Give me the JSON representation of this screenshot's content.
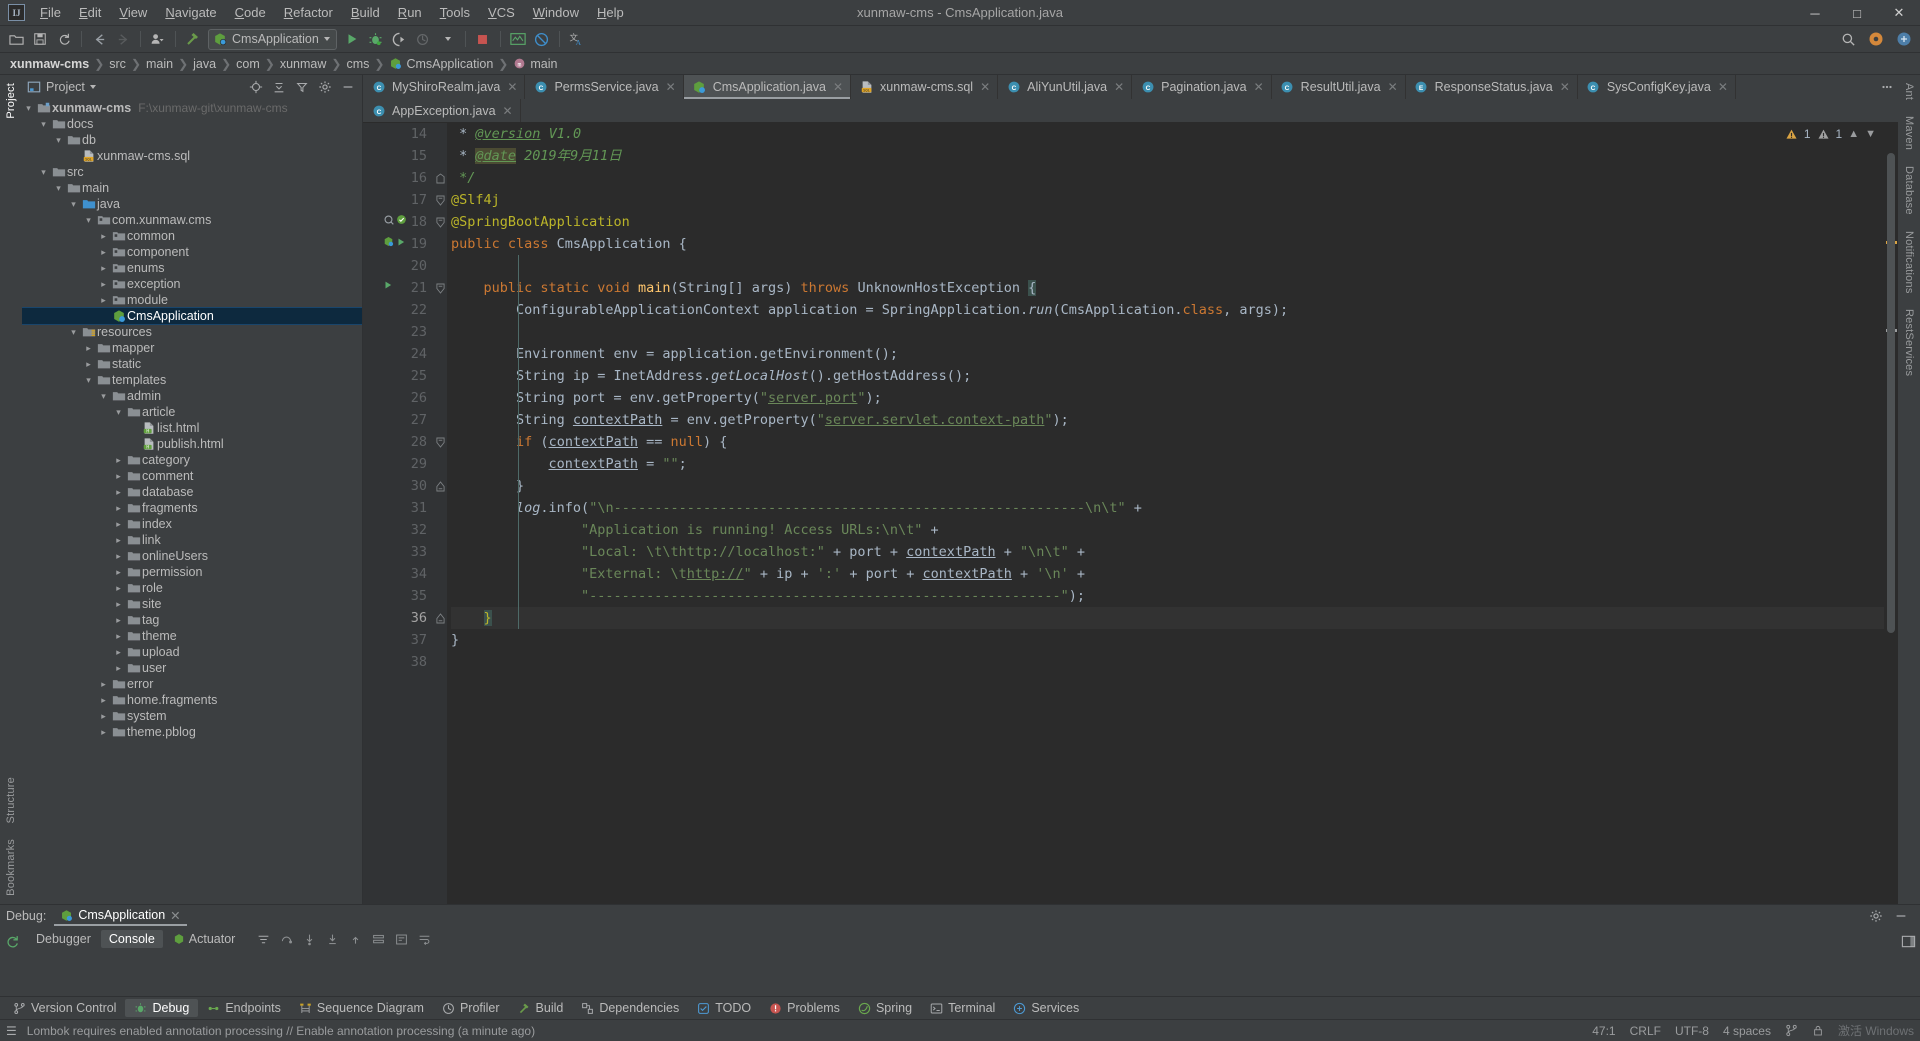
{
  "window": {
    "title": "xunmaw-cms - CmsApplication.java",
    "logo": "intellij-idea-logo",
    "minimize": "─",
    "maximize": "□",
    "close": "✕"
  },
  "menu": [
    "File",
    "Edit",
    "View",
    "Navigate",
    "Code",
    "Refactor",
    "Build",
    "Run",
    "Tools",
    "VCS",
    "Window",
    "Help"
  ],
  "toolbar": {
    "run_config": "CmsApplication",
    "icons": [
      "open-folder-icon",
      "save-all-icon",
      "sync-icon",
      "back-arrow-icon",
      "forward-arrow-icon",
      "profile-dropdown-icon",
      "build-hammer-icon",
      "run-icon",
      "debug-icon",
      "run-coverage-icon",
      "profiler-dropdown-icon",
      "stop-icon",
      "update-app-icon",
      "disabled-icon",
      "translate-icon"
    ],
    "right_icons": [
      "search-everywhere-icon",
      "ide-settings-icon",
      "layout-icon"
    ]
  },
  "breadcrumb": [
    "xunmaw-cms",
    "src",
    "main",
    "java",
    "com",
    "xunmaw",
    "cms",
    "CmsApplication",
    "main"
  ],
  "project": {
    "panel_title": "Project",
    "header_icons": [
      "locate-icon",
      "collapse-all-icon",
      "expand-filter-icon",
      "settings-gear-icon",
      "hide-icon"
    ],
    "tree": [
      {
        "depth": 0,
        "label": "xunmaw-cms",
        "path": "F:\\xunmaw-git\\xunmaw-cms",
        "icon": "module-folder-icon",
        "expanded": true,
        "bold": true
      },
      {
        "depth": 1,
        "label": "docs",
        "icon": "folder-icon",
        "expanded": true
      },
      {
        "depth": 2,
        "label": "db",
        "icon": "folder-icon",
        "expanded": true
      },
      {
        "depth": 3,
        "label": "xunmaw-cms.sql",
        "icon": "sql-file-icon",
        "leaf": true
      },
      {
        "depth": 1,
        "label": "src",
        "icon": "folder-icon",
        "expanded": true
      },
      {
        "depth": 2,
        "label": "main",
        "icon": "folder-icon",
        "expanded": true
      },
      {
        "depth": 3,
        "label": "java",
        "icon": "source-root-folder-icon",
        "expanded": true
      },
      {
        "depth": 4,
        "label": "com.xunmaw.cms",
        "icon": "package-icon",
        "expanded": true
      },
      {
        "depth": 5,
        "label": "common",
        "icon": "package-icon",
        "collapsed": true
      },
      {
        "depth": 5,
        "label": "component",
        "icon": "package-icon",
        "collapsed": true
      },
      {
        "depth": 5,
        "label": "enums",
        "icon": "package-icon",
        "collapsed": true
      },
      {
        "depth": 5,
        "label": "exception",
        "icon": "package-icon",
        "collapsed": true
      },
      {
        "depth": 5,
        "label": "module",
        "icon": "package-icon",
        "collapsed": true
      },
      {
        "depth": 5,
        "label": "CmsApplication",
        "icon": "spring-class-icon",
        "leaf": true,
        "selected": true
      },
      {
        "depth": 3,
        "label": "resources",
        "icon": "resources-root-folder-icon",
        "expanded": true
      },
      {
        "depth": 4,
        "label": "mapper",
        "icon": "folder-icon",
        "collapsed": true
      },
      {
        "depth": 4,
        "label": "static",
        "icon": "folder-icon",
        "collapsed": true
      },
      {
        "depth": 4,
        "label": "templates",
        "icon": "folder-icon",
        "expanded": true
      },
      {
        "depth": 5,
        "label": "admin",
        "icon": "folder-icon",
        "expanded": true
      },
      {
        "depth": 6,
        "label": "article",
        "icon": "folder-icon",
        "expanded": true
      },
      {
        "depth": 7,
        "label": "list.html",
        "icon": "html-file-icon",
        "leaf": true
      },
      {
        "depth": 7,
        "label": "publish.html",
        "icon": "html-file-icon",
        "leaf": true
      },
      {
        "depth": 6,
        "label": "category",
        "icon": "folder-icon",
        "collapsed": true
      },
      {
        "depth": 6,
        "label": "comment",
        "icon": "folder-icon",
        "collapsed": true
      },
      {
        "depth": 6,
        "label": "database",
        "icon": "folder-icon",
        "collapsed": true
      },
      {
        "depth": 6,
        "label": "fragments",
        "icon": "folder-icon",
        "collapsed": true
      },
      {
        "depth": 6,
        "label": "index",
        "icon": "folder-icon",
        "collapsed": true
      },
      {
        "depth": 6,
        "label": "link",
        "icon": "folder-icon",
        "collapsed": true
      },
      {
        "depth": 6,
        "label": "onlineUsers",
        "icon": "folder-icon",
        "collapsed": true
      },
      {
        "depth": 6,
        "label": "permission",
        "icon": "folder-icon",
        "collapsed": true
      },
      {
        "depth": 6,
        "label": "role",
        "icon": "folder-icon",
        "collapsed": true
      },
      {
        "depth": 6,
        "label": "site",
        "icon": "folder-icon",
        "collapsed": true
      },
      {
        "depth": 6,
        "label": "tag",
        "icon": "folder-icon",
        "collapsed": true
      },
      {
        "depth": 6,
        "label": "theme",
        "icon": "folder-icon",
        "collapsed": true
      },
      {
        "depth": 6,
        "label": "upload",
        "icon": "folder-icon",
        "collapsed": true
      },
      {
        "depth": 6,
        "label": "user",
        "icon": "folder-icon",
        "collapsed": true
      },
      {
        "depth": 5,
        "label": "error",
        "icon": "folder-icon",
        "collapsed": true
      },
      {
        "depth": 5,
        "label": "home.fragments",
        "icon": "folder-icon",
        "collapsed": true
      },
      {
        "depth": 5,
        "label": "system",
        "icon": "folder-icon",
        "collapsed": true
      },
      {
        "depth": 5,
        "label": "theme.pblog",
        "icon": "folder-icon",
        "collapsed": true
      }
    ]
  },
  "editor": {
    "tabs_row1": [
      {
        "label": "MyShiroRealm.java",
        "icon": "java-class-icon",
        "active": false
      },
      {
        "label": "PermsService.java",
        "icon": "java-class-icon",
        "active": false
      },
      {
        "label": "CmsApplication.java",
        "icon": "spring-class-icon",
        "active": true
      },
      {
        "label": "xunmaw-cms.sql",
        "icon": "sql-file-icon",
        "active": false
      },
      {
        "label": "AliYunUtil.java",
        "icon": "java-class-icon",
        "active": false
      },
      {
        "label": "Pagination.java",
        "icon": "java-class-icon",
        "active": false
      },
      {
        "label": "ResultUtil.java",
        "icon": "java-class-icon",
        "active": false
      },
      {
        "label": "ResponseStatus.java",
        "icon": "java-enum-icon",
        "active": false
      },
      {
        "label": "SysConfigKey.java",
        "icon": "java-class-icon",
        "active": false
      }
    ],
    "tabs_row2": [
      {
        "label": "AppException.java",
        "icon": "java-class-icon",
        "active": false
      }
    ],
    "first_line": 14,
    "current_line": 36,
    "inspections": {
      "warnings": "1",
      "weak_warnings": "1"
    },
    "lines": [
      {
        "n": 14,
        "text": " * @version V1.0"
      },
      {
        "n": 15,
        "text": " * @date 2019年9月11日"
      },
      {
        "n": 16,
        "text": " */"
      },
      {
        "n": 17,
        "text": "@Slf4j"
      },
      {
        "n": 18,
        "text": "@SpringBootApplication"
      },
      {
        "n": 19,
        "text": "public class CmsApplication {"
      },
      {
        "n": 20,
        "text": ""
      },
      {
        "n": 21,
        "text": "    public static void main(String[] args) throws UnknownHostException {"
      },
      {
        "n": 22,
        "text": "        ConfigurableApplicationContext application = SpringApplication.run(CmsApplication.class, args);"
      },
      {
        "n": 23,
        "text": ""
      },
      {
        "n": 24,
        "text": "        Environment env = application.getEnvironment();"
      },
      {
        "n": 25,
        "text": "        String ip = InetAddress.getLocalHost().getHostAddress();"
      },
      {
        "n": 26,
        "text": "        String port = env.getProperty(\"server.port\");"
      },
      {
        "n": 27,
        "text": "        String contextPath = env.getProperty(\"server.servlet.context-path\");"
      },
      {
        "n": 28,
        "text": "        if (contextPath == null) {"
      },
      {
        "n": 29,
        "text": "            contextPath = \"\";"
      },
      {
        "n": 30,
        "text": "        }"
      },
      {
        "n": 31,
        "text": "        log.info(\"\\n----------------------------------------------------------\\n\\t\" +"
      },
      {
        "n": 32,
        "text": "                \"Application is running! Access URLs:\\n\\t\" +"
      },
      {
        "n": 33,
        "text": "                \"Local: \\t\\thttp://localhost:\" + port + contextPath + \"\\n\\t\" +"
      },
      {
        "n": 34,
        "text": "                \"External: \\thttp://\" + ip + ':' + port + contextPath + '\\n' +"
      },
      {
        "n": 35,
        "text": "                \"----------------------------------------------------------\");"
      },
      {
        "n": 36,
        "text": "    }"
      },
      {
        "n": 37,
        "text": "}"
      },
      {
        "n": 38,
        "text": ""
      }
    ]
  },
  "debug": {
    "label": "Debug:",
    "session_tab": "CmsApplication",
    "tabs": [
      "Debugger",
      "Console",
      "Actuator"
    ],
    "active_tab": "Console",
    "tool_icons": [
      "rerun-icon",
      "settings-gear-icon",
      "hide-icon",
      "layout-settings-icon"
    ],
    "side_icons": [
      "restart-icon"
    ],
    "bar_icons": [
      "filter-icon",
      "step-over-icon",
      "step-into-icon",
      "force-step-into-icon",
      "step-out-icon",
      "drop-frame-icon",
      "evaluate-icon",
      "soft-wrap-icon"
    ]
  },
  "toolstrip": [
    {
      "label": "Version Control",
      "icon": "version-control-icon",
      "selected": false
    },
    {
      "label": "Debug",
      "icon": "debug-icon",
      "selected": true
    },
    {
      "label": "Endpoints",
      "icon": "endpoints-icon",
      "selected": false
    },
    {
      "label": "Sequence Diagram",
      "icon": "sequence-diagram-icon",
      "selected": false
    },
    {
      "label": "Profiler",
      "icon": "profiler-icon",
      "selected": false
    },
    {
      "label": "Build",
      "icon": "build-icon",
      "selected": false
    },
    {
      "label": "Dependencies",
      "icon": "dependencies-icon",
      "selected": false
    },
    {
      "label": "TODO",
      "icon": "todo-icon",
      "selected": false
    },
    {
      "label": "Problems",
      "icon": "problems-icon",
      "selected": false
    },
    {
      "label": "Spring",
      "icon": "spring-icon",
      "selected": false
    },
    {
      "label": "Terminal",
      "icon": "terminal-icon",
      "selected": false
    },
    {
      "label": "Services",
      "icon": "services-icon",
      "selected": false
    }
  ],
  "left_strip": [
    "Project",
    "Structure",
    "Bookmarks"
  ],
  "right_strip": [
    "Ant",
    "Maven",
    "Database",
    "Notifications",
    "RestServices"
  ],
  "statusbar": {
    "message": "Lombok requires enabled annotation processing // Enable annotation processing (a minute ago)",
    "caret": "47:1",
    "line_sep": "CRLF",
    "encoding": "UTF-8",
    "indent": "4 spaces",
    "branch": "git-branch-icon",
    "lock": "lock-icon",
    "watermark": "激活 Windows"
  },
  "colors": {
    "bg": "#3c3f41",
    "editor_bg": "#2b2b2b",
    "gutter": "#313335",
    "accent": "#4b6eaf",
    "selection": "#0d293e",
    "keyword": "#cc7832",
    "string": "#6a8759",
    "annotation": "#bbb529",
    "comment": "#629755",
    "method": "#ffc66d",
    "text": "#a9b7c6"
  }
}
